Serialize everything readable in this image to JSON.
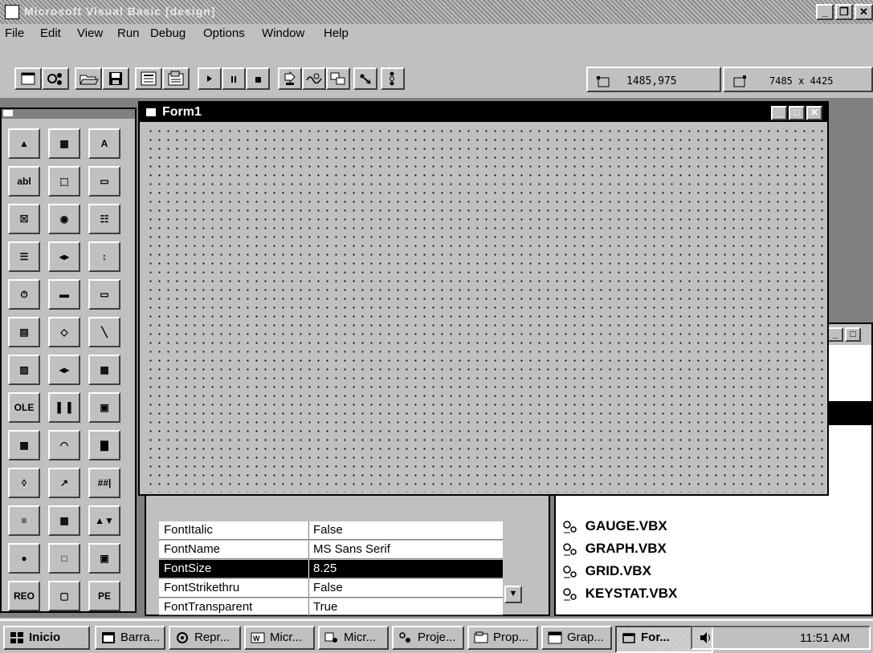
{
  "window": {
    "title": "Microsoft Visual Basic [design]"
  },
  "menu": [
    {
      "label": "File"
    },
    {
      "label": "Edit"
    },
    {
      "label": "View"
    },
    {
      "label": "Run"
    },
    {
      "label": "Debug"
    },
    {
      "label": "Options"
    },
    {
      "label": "Window"
    },
    {
      "label": "Help"
    }
  ],
  "toolbar": {
    "position_readout": "1485,975",
    "size_readout": "7485 x 4425"
  },
  "toolbox": {
    "tools": [
      "pointer-icon",
      "picturebox-icon",
      "label-icon",
      "textbox-icon",
      "frame-icon",
      "commandbutton-icon",
      "checkbox-icon",
      "optionbutton-icon",
      "combobox-icon",
      "listbox-icon",
      "hscrollbar-icon",
      "vscrollbar-icon",
      "timer-icon",
      "drivelistbox-icon",
      "dirlistbox-icon",
      "filelistbox-icon",
      "shape-icon",
      "line-icon",
      "image-icon",
      "data-icon",
      "grid-icon",
      "ole-icon",
      "animation-icon",
      "msgblaster-icon",
      "commondialog-icon",
      "gauge-icon",
      "graph-icon",
      "map-icon",
      "spin-icon",
      "masked-edit-icon",
      "outline-icon",
      "spreadsheet-icon",
      "updown-icon",
      "keystat-icon",
      "picclip-icon",
      "dbgrid-icon",
      "report-icon",
      "frame3d-icon",
      "panel-icon"
    ],
    "tool_labels": {
      "label": "A",
      "textbox": "abl",
      "ole": "OLE 2.0",
      "masked": "##|",
      "report": "REO",
      "keystat": "PE"
    }
  },
  "form": {
    "title": "Form1"
  },
  "properties": {
    "rows": [
      {
        "name": "FontItalic",
        "value": "False"
      },
      {
        "name": "FontName",
        "value": "MS Sans Serif"
      },
      {
        "name": "FontSize",
        "value": "8.25",
        "selected": true
      },
      {
        "name": "FontStrikethru",
        "value": "False"
      },
      {
        "name": "FontTransparent",
        "value": "True"
      }
    ]
  },
  "project": {
    "files": [
      {
        "name": "GAUGE.VBX"
      },
      {
        "name": "GRAPH.VBX"
      },
      {
        "name": "GRID.VBX"
      },
      {
        "name": "KEYSTAT.VBX"
      }
    ]
  },
  "taskbar": {
    "start": "Inicio",
    "tasks": [
      {
        "label": "Barra..."
      },
      {
        "label": "Repr..."
      },
      {
        "label": "Micr..."
      },
      {
        "label": "Micr..."
      },
      {
        "label": "Proje..."
      },
      {
        "label": "Prop..."
      },
      {
        "label": "Grap..."
      },
      {
        "label": "For...",
        "active": true
      }
    ],
    "clock": "11:51 AM"
  },
  "colors": {
    "selection": "#000000",
    "face": "#c0c0c0",
    "mdi_background": "#808080"
  }
}
